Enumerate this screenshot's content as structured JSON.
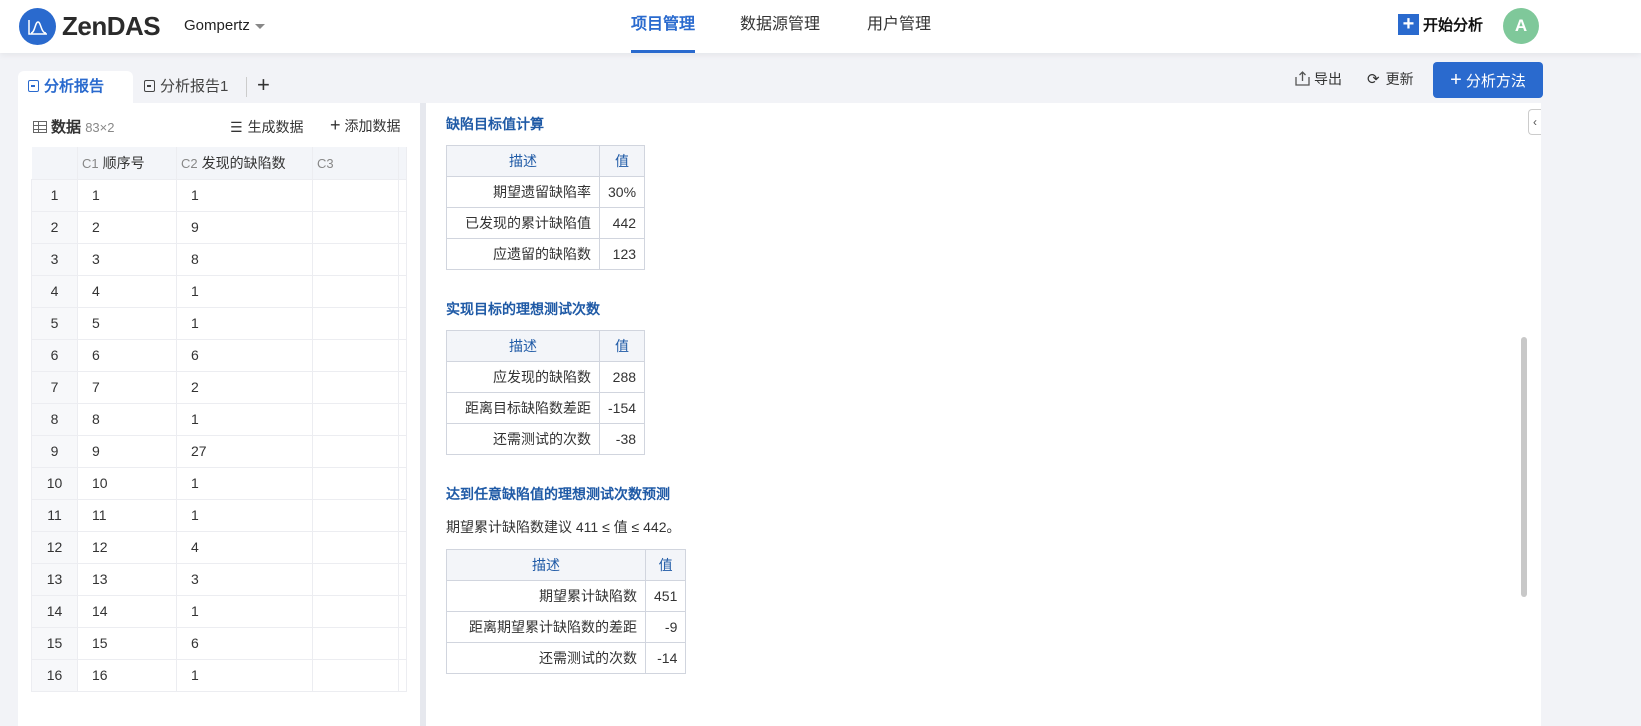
{
  "header": {
    "logo": "ZenDAS",
    "project": "Gompertz",
    "nav": [
      "项目管理",
      "数据源管理",
      "用户管理"
    ],
    "start": "开始分析",
    "avatar": "A"
  },
  "tabs": [
    "分析报告",
    "分析报告1"
  ],
  "toolbar": {
    "export": "导出",
    "refresh": "更新",
    "add_method": "分析方法"
  },
  "data_panel": {
    "title": "数据",
    "dims": "83×2",
    "generate": "生成数据",
    "add": "添加数据",
    "columns": [
      {
        "id": "C1",
        "name": "顺序号"
      },
      {
        "id": "C2",
        "name": "发现的缺陷数"
      },
      {
        "id": "C3",
        "name": ""
      }
    ],
    "rows": [
      [
        1,
        1,
        1
      ],
      [
        2,
        2,
        9
      ],
      [
        3,
        3,
        8
      ],
      [
        4,
        4,
        1
      ],
      [
        5,
        5,
        1
      ],
      [
        6,
        6,
        6
      ],
      [
        7,
        7,
        2
      ],
      [
        8,
        8,
        1
      ],
      [
        9,
        9,
        27
      ],
      [
        10,
        10,
        1
      ],
      [
        11,
        11,
        1
      ],
      [
        12,
        12,
        4
      ],
      [
        13,
        13,
        3
      ],
      [
        14,
        14,
        1
      ],
      [
        15,
        15,
        6
      ],
      [
        16,
        16,
        1
      ]
    ]
  },
  "report": {
    "s1": {
      "title": "缺陷目标值计算",
      "headers": [
        "描述",
        "值"
      ],
      "rows": [
        [
          "期望遗留缺陷率",
          "30%"
        ],
        [
          "已发现的累计缺陷值",
          "442"
        ],
        [
          "应遗留的缺陷数",
          "123"
        ]
      ]
    },
    "s2": {
      "title": "实现目标的理想测试次数",
      "headers": [
        "描述",
        "值"
      ],
      "rows": [
        [
          "应发现的缺陷数",
          "288"
        ],
        [
          "距离目标缺陷数差距",
          "-154"
        ],
        [
          "还需测试的次数",
          "-38"
        ]
      ]
    },
    "s3": {
      "title": "达到任意缺陷值的理想测试次数预测",
      "note": "期望累计缺陷数建议 411 ≤ 值 ≤ 442。",
      "headers": [
        "描述",
        "值"
      ],
      "rows": [
        [
          "期望累计缺陷数",
          "451"
        ],
        [
          "距离期望累计缺陷数的差距",
          "-9"
        ],
        [
          "还需测试的次数",
          "-14"
        ]
      ]
    }
  }
}
